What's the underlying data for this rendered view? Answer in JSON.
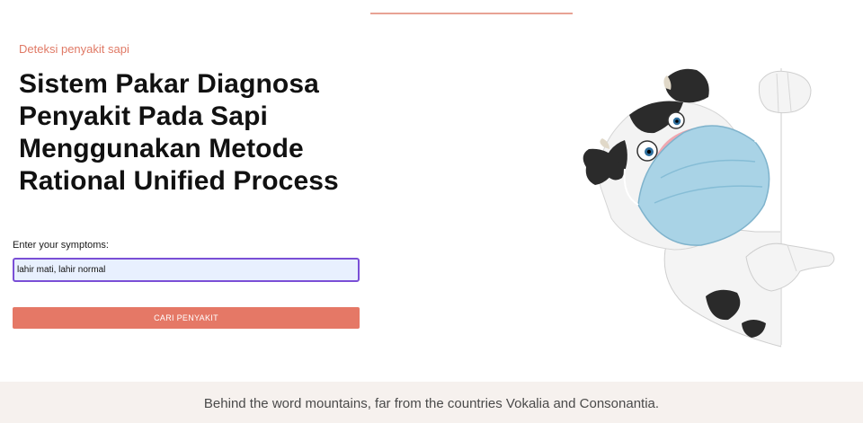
{
  "hero": {
    "eyebrow": "Deteksi penyakit sapi",
    "title": "Sistem Pakar Diagnosa Penyakit Pada Sapi Menggunakan Metode Rational Unified Process"
  },
  "form": {
    "label": "Enter your symptoms:",
    "value": "lahir mati, lahir normal",
    "button_label": "CARI PENYAKIT"
  },
  "illustration": {
    "icon": "cow-with-mask-illustration"
  },
  "footer": {
    "text": "Behind the word mountains, far from the countries Vokalia and Consonantia."
  },
  "colors": {
    "accent": "#e57866",
    "input_border": "#7a4fd6",
    "input_fill": "#e8f0fe",
    "footer_bg": "#f6f1ee"
  }
}
